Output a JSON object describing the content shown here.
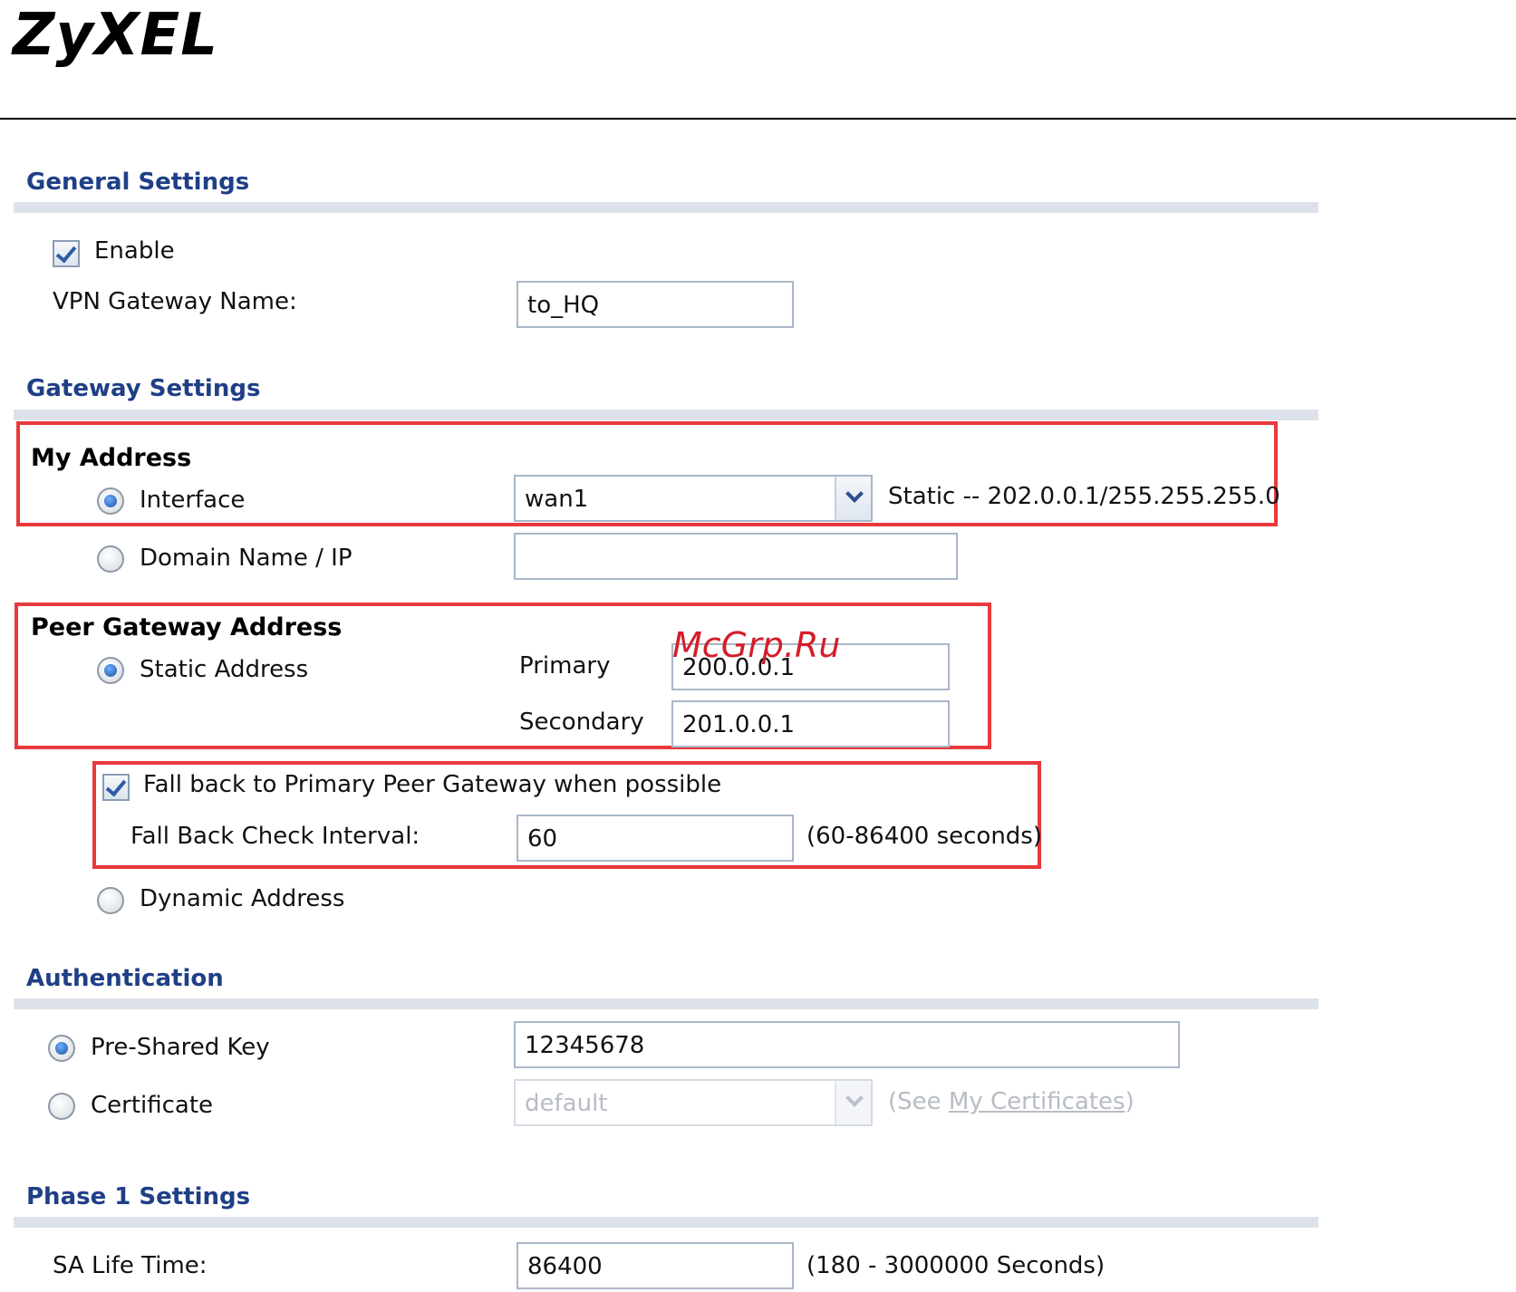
{
  "brand": {
    "logo_text": "ZyXEL"
  },
  "watermark": "McGrp.Ru",
  "general": {
    "title": "General Settings",
    "enable_label": "Enable",
    "enable_checked": true,
    "gateway_name_label": "VPN Gateway Name:",
    "gateway_name_value": "to_HQ"
  },
  "gateway": {
    "title": "Gateway Settings",
    "my_address": {
      "heading": "My Address",
      "interface_label": "Interface",
      "interface_selected": true,
      "interface_value": "wan1",
      "interface_info": "Static -- 202.0.0.1/255.255.255.0",
      "domain_label": "Domain Name / IP",
      "domain_value": ""
    },
    "peer": {
      "heading": "Peer Gateway Address",
      "static_label": "Static Address",
      "static_selected": true,
      "primary_label": "Primary",
      "primary_value": "200.0.0.1",
      "secondary_label": "Secondary",
      "secondary_value": "201.0.0.1",
      "fallback_label": "Fall back to Primary Peer Gateway when possible",
      "fallback_checked": true,
      "interval_label": "Fall Back Check Interval:",
      "interval_value": "60",
      "interval_hint": "(60-86400 seconds)",
      "dynamic_label": "Dynamic Address"
    }
  },
  "auth": {
    "title": "Authentication",
    "psk_label": "Pre-Shared Key",
    "psk_selected": true,
    "psk_value": "12345678",
    "cert_label": "Certificate",
    "cert_value": "default",
    "cert_hint_prefix": "(See ",
    "cert_hint_link": "My Certificates",
    "cert_hint_suffix": ")"
  },
  "phase1": {
    "title": "Phase 1 Settings",
    "sa_label": "SA Life Time:",
    "sa_value": "86400",
    "sa_hint": "(180 - 3000000 Seconds)"
  },
  "colors": {
    "section_title": "#1f3f86",
    "section_bar": "#dde2ea",
    "highlight_box": "#e8393c",
    "watermark": "#d41e2a"
  }
}
